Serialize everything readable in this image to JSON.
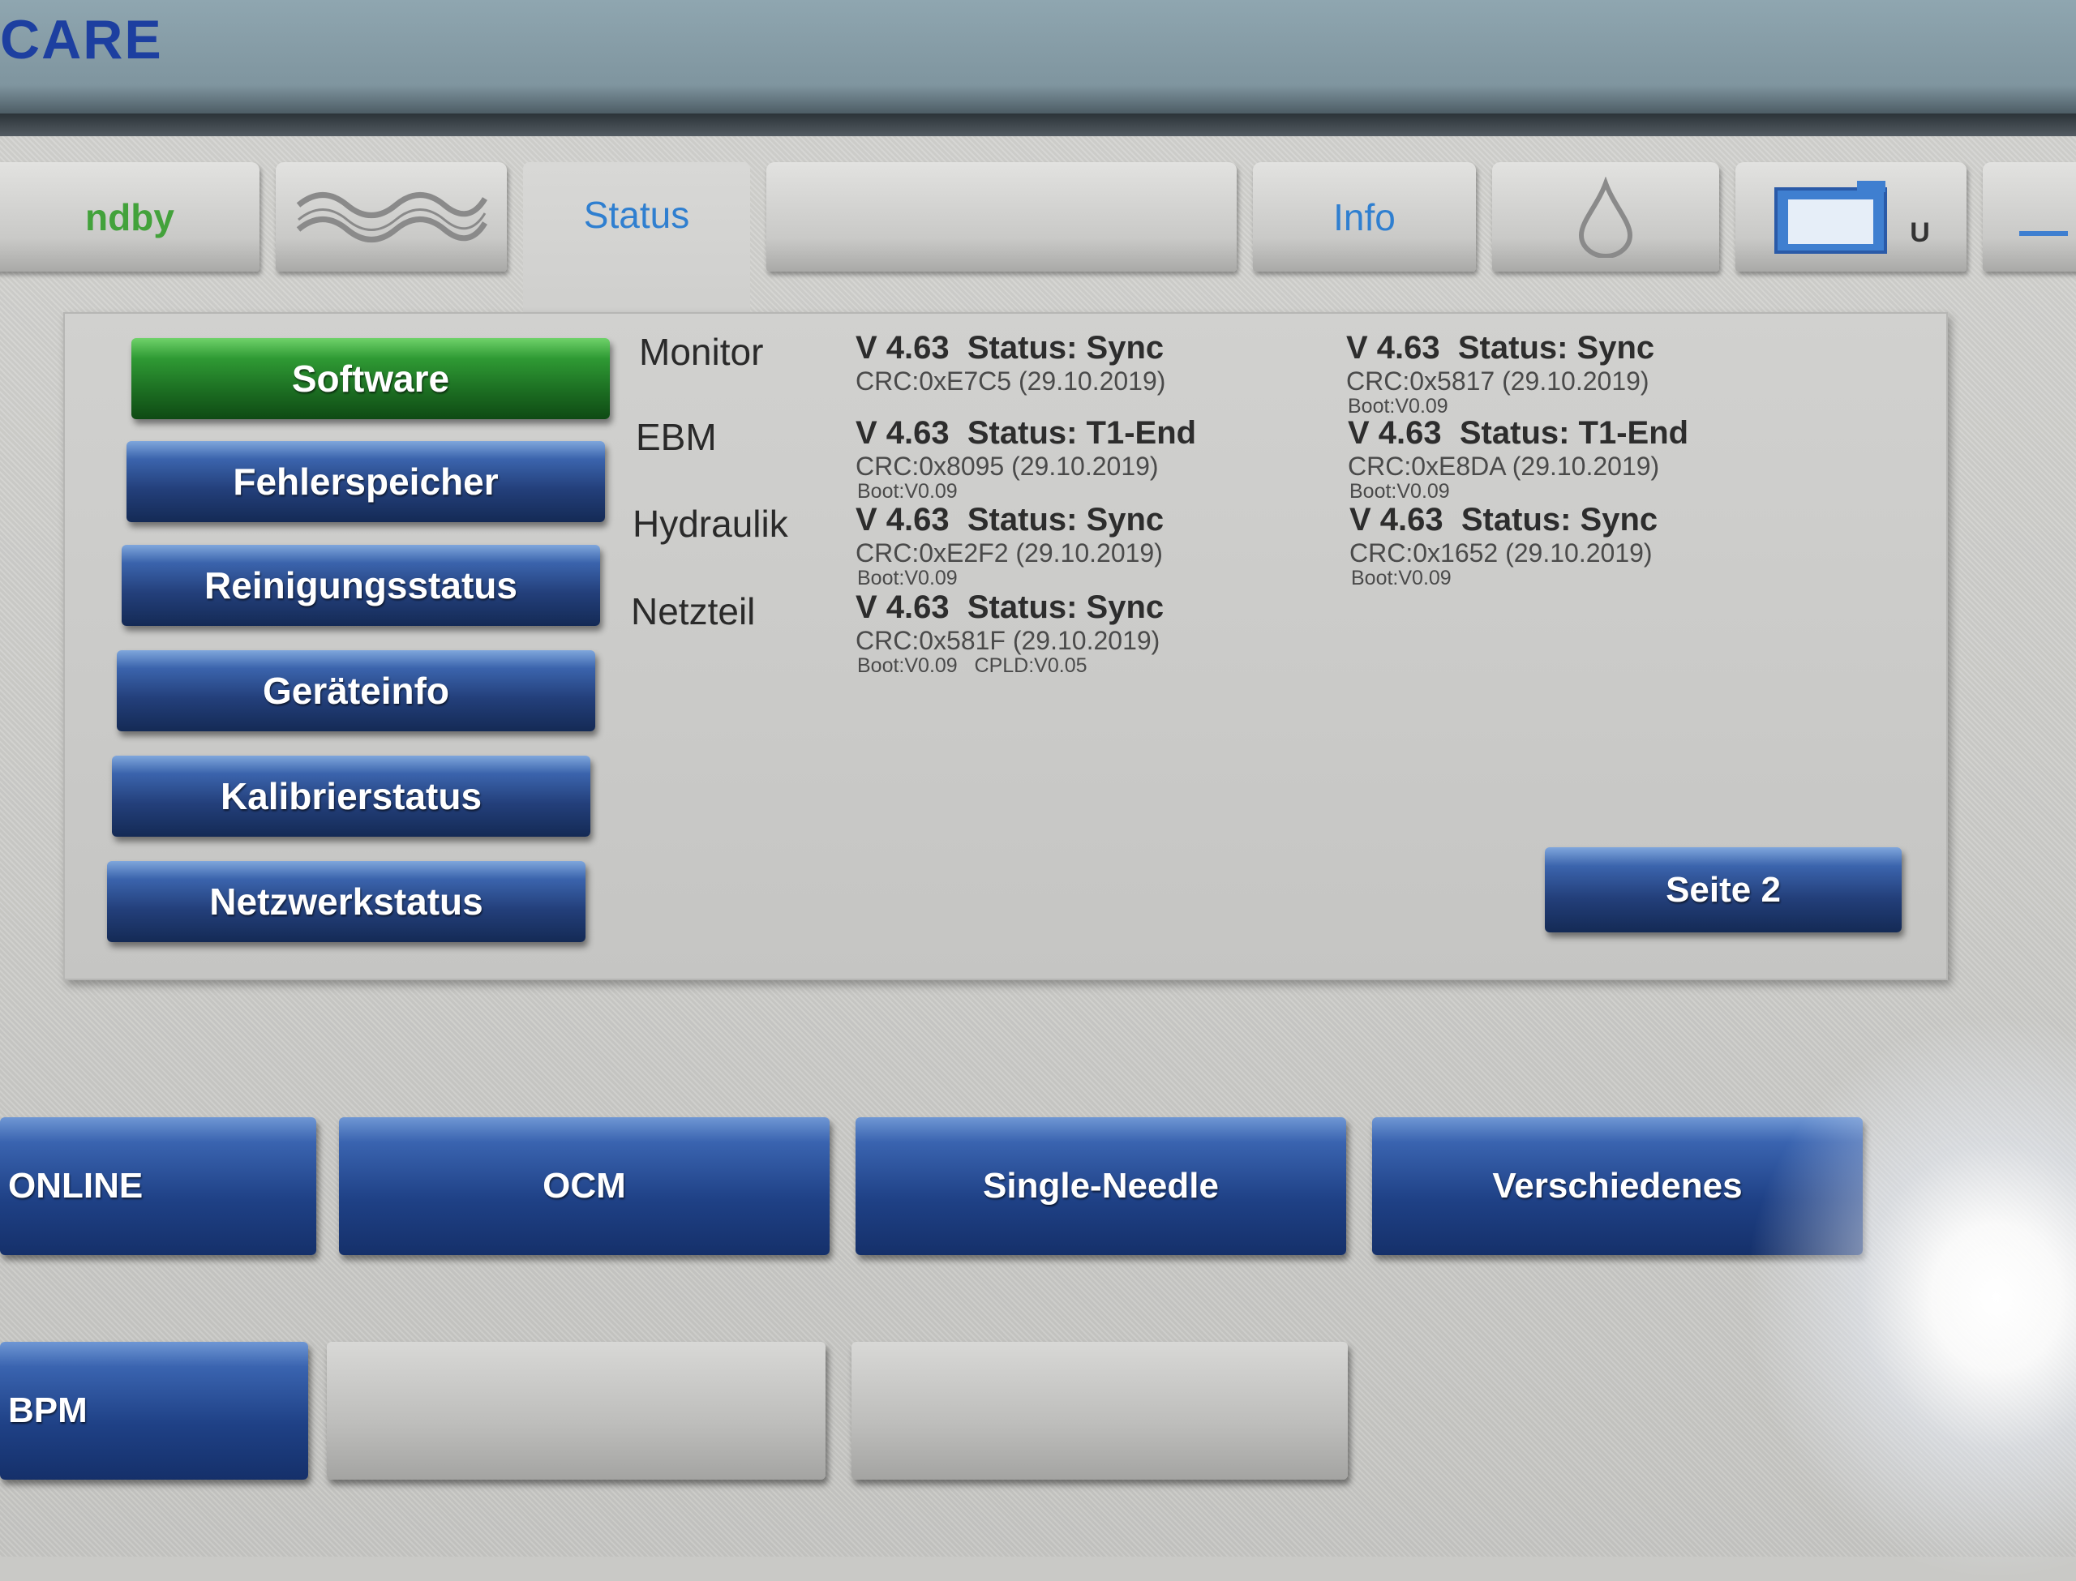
{
  "header": {
    "brand": "CARE"
  },
  "tabs": {
    "standby": "ndby",
    "status": "Status",
    "info": "Info",
    "u_label": "U"
  },
  "sidebar": {
    "items": [
      {
        "label": "Software"
      },
      {
        "label": "Fehlerspeicher"
      },
      {
        "label": "Reinigungsstatus"
      },
      {
        "label": "Geräteinfo"
      },
      {
        "label": "Kalibrierstatus"
      },
      {
        "label": "Netzwerkstatus"
      }
    ]
  },
  "modules": [
    {
      "name": "Monitor",
      "a": {
        "version": "V 4.63  Status: Sync",
        "crc": "CRC:0xE7C5 (29.10.2019)",
        "boot": ""
      },
      "b": {
        "version": "V 4.63  Status: Sync",
        "crc": "CRC:0x5817 (29.10.2019)",
        "boot": "Boot:V0.09"
      }
    },
    {
      "name": "EBM",
      "a": {
        "version": "V 4.63  Status: T1-End",
        "crc": "CRC:0x8095 (29.10.2019)",
        "boot": "Boot:V0.09"
      },
      "b": {
        "version": "V 4.63  Status: T1-End",
        "crc": "CRC:0xE8DA (29.10.2019)",
        "boot": "Boot:V0.09"
      }
    },
    {
      "name": "Hydraulik",
      "a": {
        "version": "V 4.63  Status: Sync",
        "crc": "CRC:0xE2F2 (29.10.2019)",
        "boot": "Boot:V0.09"
      },
      "b": {
        "version": "V 4.63  Status: Sync",
        "crc": "CRC:0x1652 (29.10.2019)",
        "boot": "Boot:V0.09"
      }
    },
    {
      "name": "Netzteil",
      "a": {
        "version": "V 4.63  Status: Sync",
        "crc": "CRC:0x581F (29.10.2019)",
        "boot": "Boot:V0.09   CPLD:V0.05"
      }
    }
  ],
  "panel": {
    "page_button": "Seite 2"
  },
  "bottom": {
    "row1": [
      "ONLINE",
      "OCM",
      "Single-Needle",
      "Verschiedenes"
    ],
    "row2": [
      "BPM",
      "",
      ""
    ]
  },
  "colors": {
    "brand": "#1d3fa0",
    "tab_text": "#2f7fd0",
    "standby_text": "#43a23b",
    "active_button": "#1c6e22",
    "button": "#233f7a"
  },
  "icons": [
    "wave-icon",
    "drop-icon",
    "display-icon"
  ]
}
